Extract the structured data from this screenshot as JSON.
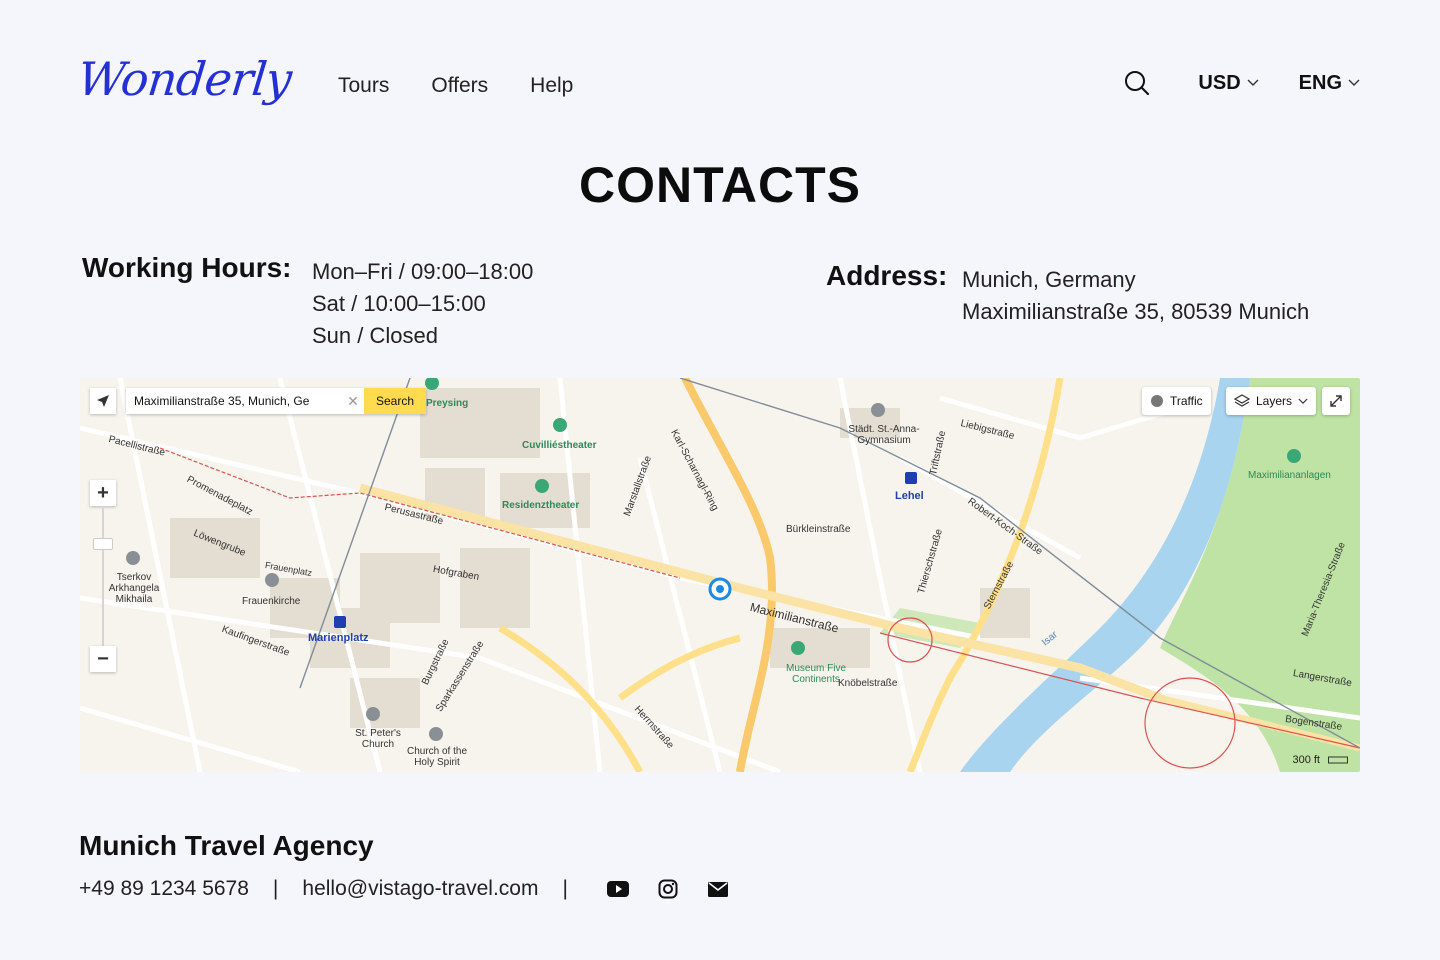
{
  "header": {
    "logo": "Wonderly",
    "nav": [
      "Tours",
      "Offers",
      "Help"
    ],
    "currency": "USD",
    "language": "ENG"
  },
  "page": {
    "title": "CONTACTS"
  },
  "hours": {
    "label": "Working Hours:",
    "lines": [
      "Mon–Fri / 09:00–18:00",
      "Sat / 10:00–15:00",
      "Sun / Closed"
    ]
  },
  "address": {
    "label": "Address:",
    "lines": [
      "Munich, Germany",
      "Maximilianstraße 35, 80539 Munich"
    ]
  },
  "map": {
    "search_value": "Maximilianstraße 35, Munich, Ge",
    "search_button": "Search",
    "traffic": "Traffic",
    "layers": "Layers",
    "scale": "300 ft",
    "labels": [
      "Cuvilliéstheater",
      "Residenztheater",
      "Preysing",
      "Karl-Scharnagl-Ring",
      "Maximilianstraße",
      "Marienplatz",
      "Frauenkirche",
      "Lehel",
      "Städt. St.-Anna-Gymnasium",
      "Maximiliananlagen",
      "Museum Five Continents",
      "Hofgraben",
      "Sparkassenstraße",
      "Liebigstraße",
      "Robert-Koch-Straße",
      "Sternstraße",
      "Langerstraße",
      "Bogenstraße",
      "Pacellistraße",
      "Promenadeplatz",
      "Perusastraße",
      "Löwengrube",
      "Tserkov Arkhangela Mikhaila",
      "St. Peter's Church",
      "Church of the Holy Spirit",
      "Kaufingerstraße",
      "Thierschstraße",
      "Triftstraße",
      "Bürkleinstraße",
      "Knöbelstraße",
      "Maria-Theresia-Straße",
      "Isar",
      "Marstallstraße",
      "Herrnstraße",
      "Frauenplatz",
      "Burgstraße"
    ]
  },
  "footer": {
    "agency": "Munich Travel Agency",
    "phone": "+49 89 1234 5678",
    "divider": "|",
    "email": "hello@vistago-travel.com"
  },
  "colors": {
    "brand": "#2430d4",
    "background": "#f5f6fb",
    "map_accent": "#ffdb4d",
    "map_pin": "#1e88e5"
  }
}
